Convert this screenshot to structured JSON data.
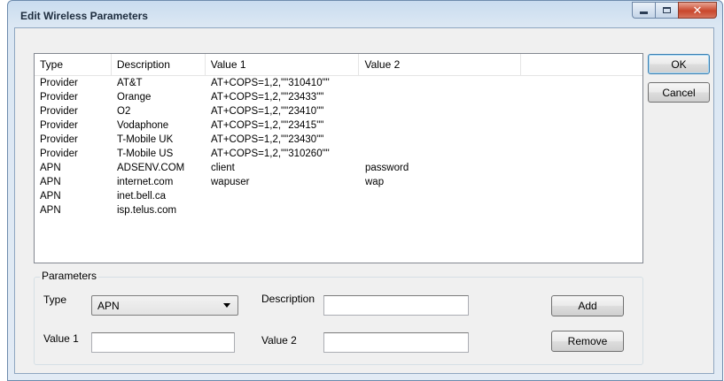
{
  "window": {
    "title": "Edit Wireless Parameters",
    "minimize_glyph": "",
    "maximize_glyph": "",
    "close_glyph": "✕"
  },
  "list": {
    "columns": [
      "Type",
      "Description",
      "Value 1",
      "Value 2",
      ""
    ],
    "rows": [
      [
        "Provider",
        "AT&T",
        "AT+COPS=1,2,\"\"310410\"\"",
        ""
      ],
      [
        "Provider",
        "Orange",
        "AT+COPS=1,2,\"\"23433\"\"",
        ""
      ],
      [
        "Provider",
        "O2",
        "AT+COPS=1,2,\"\"23410\"\"",
        ""
      ],
      [
        "Provider",
        "Vodaphone",
        "AT+COPS=1,2,\"\"23415\"\"",
        ""
      ],
      [
        "Provider",
        "T-Mobile UK",
        "AT+COPS=1,2,\"\"23430\"\"",
        ""
      ],
      [
        "Provider",
        "T-Mobile US",
        "AT+COPS=1,2,\"\"310260\"\"",
        ""
      ],
      [
        "APN",
        "ADSENV.COM",
        "client",
        "password"
      ],
      [
        "APN",
        "internet.com",
        "wapuser",
        "wap"
      ],
      [
        "APN",
        "inet.bell.ca",
        "",
        ""
      ],
      [
        "APN",
        "isp.telus.com",
        "",
        ""
      ]
    ]
  },
  "buttons": {
    "ok": "OK",
    "cancel": "Cancel",
    "add": "Add",
    "remove": "Remove"
  },
  "parameters": {
    "group_label": "Parameters",
    "type_label": "Type",
    "type_value": "APN",
    "description_label": "Description",
    "description_value": "",
    "value1_label": "Value 1",
    "value1_value": "",
    "value2_label": "Value 2",
    "value2_value": ""
  }
}
